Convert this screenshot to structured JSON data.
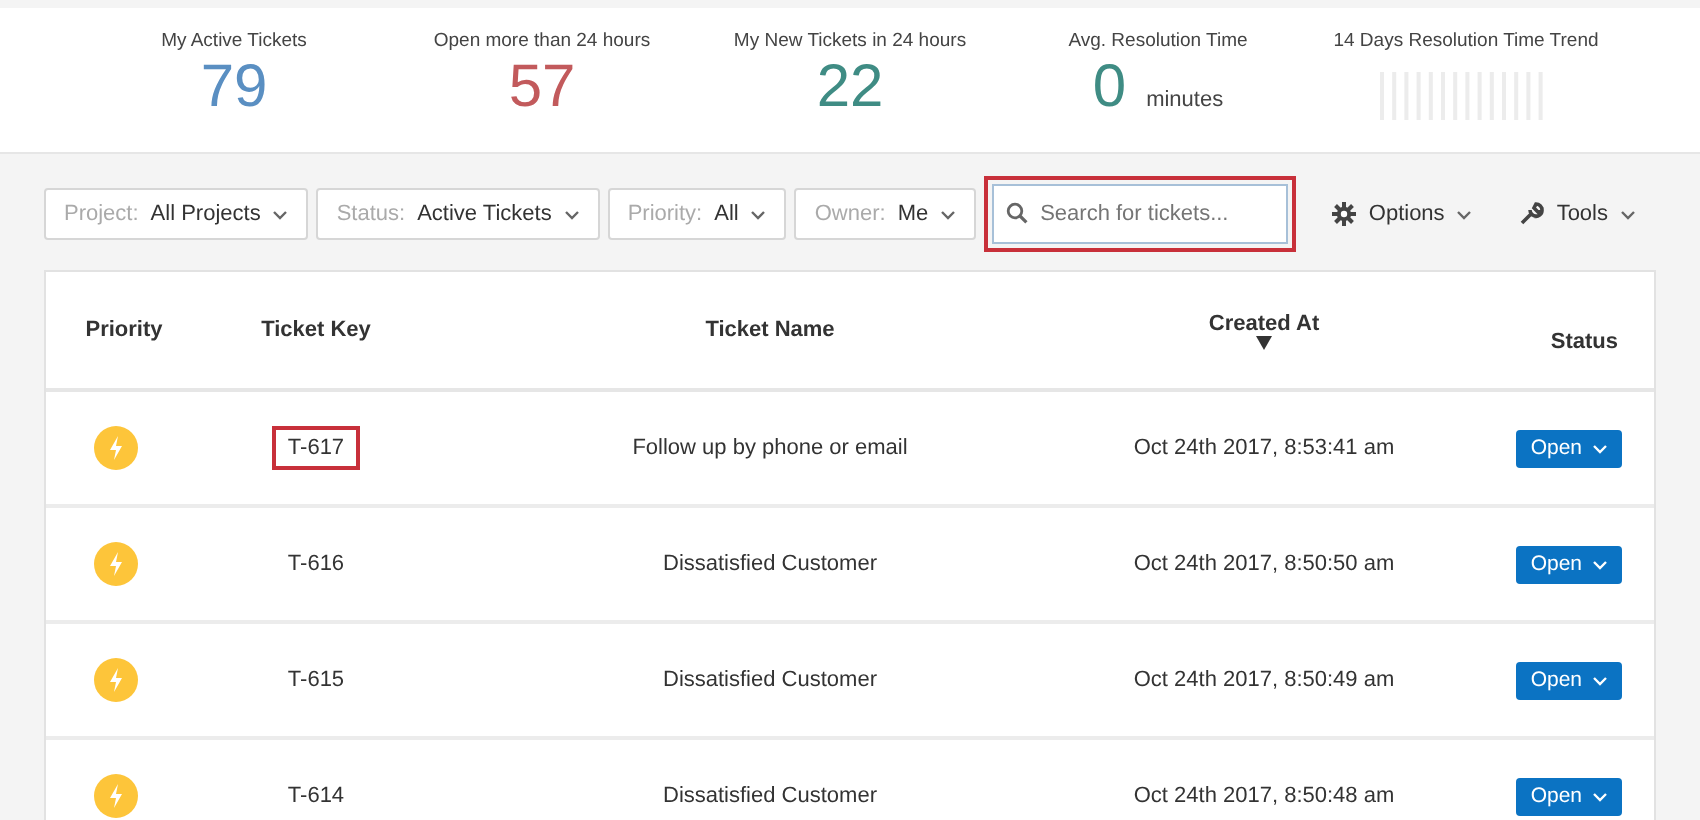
{
  "stats": [
    {
      "label": "My Active Tickets",
      "value": "79",
      "color": "#5a8fc2"
    },
    {
      "label": "Open more than 24 hours",
      "value": "57",
      "color": "#c25a5c"
    },
    {
      "label": "My New Tickets in 24 hours",
      "value": "22",
      "color": "#3f8c84"
    },
    {
      "label": "Avg. Resolution Time",
      "value": "0",
      "unit": "minutes",
      "color": "#3f8c84"
    }
  ],
  "trend": {
    "label": "14 Days Resolution Time Trend"
  },
  "filters": [
    {
      "label": "Project:",
      "value": "All Projects"
    },
    {
      "label": "Status:",
      "value": "Active Tickets"
    },
    {
      "label": "Priority:",
      "value": "All"
    },
    {
      "label": "Owner:",
      "value": "Me"
    }
  ],
  "search": {
    "placeholder": "Search for tickets...",
    "highlighted": true
  },
  "toolbar": [
    {
      "label": "Options",
      "kind": "gear"
    },
    {
      "label": "Tools",
      "kind": "wrench"
    }
  ],
  "table": {
    "columns": [
      {
        "label": "Priority",
        "sorted": false
      },
      {
        "label": "Ticket Key",
        "sorted": false
      },
      {
        "label": "Ticket Name",
        "sorted": false
      },
      {
        "label": "Created At",
        "sorted": true
      },
      {
        "label": "Status",
        "sorted": false
      }
    ],
    "rows": [
      {
        "key": "T-617",
        "key_highlighted": true,
        "name": "Follow up by phone or email",
        "created": "Oct 24th 2017, 8:53:41 am",
        "status": "Open"
      },
      {
        "key": "T-616",
        "key_highlighted": false,
        "name": "Dissatisfied Customer",
        "created": "Oct 24th 2017, 8:50:50 am",
        "status": "Open"
      },
      {
        "key": "T-615",
        "key_highlighted": false,
        "name": "Dissatisfied Customer",
        "created": "Oct 24th 2017, 8:50:49 am",
        "status": "Open"
      },
      {
        "key": "T-614",
        "key_highlighted": false,
        "name": "Dissatisfied Customer",
        "created": "Oct 24th 2017, 8:50:48 am",
        "status": "Open"
      }
    ]
  }
}
